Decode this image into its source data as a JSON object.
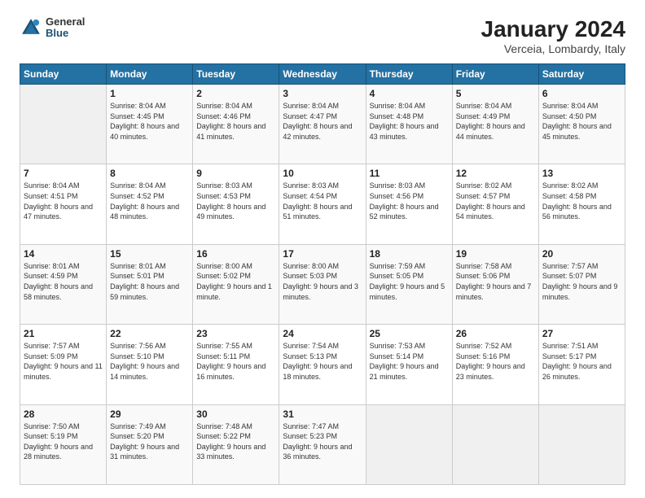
{
  "header": {
    "logo": {
      "general": "General",
      "blue": "Blue"
    },
    "title": "January 2024",
    "subtitle": "Verceia, Lombardy, Italy"
  },
  "weekdays": [
    "Sunday",
    "Monday",
    "Tuesday",
    "Wednesday",
    "Thursday",
    "Friday",
    "Saturday"
  ],
  "weeks": [
    [
      {
        "day": "",
        "sunrise": "",
        "sunset": "",
        "daylight": "",
        "empty": true
      },
      {
        "day": "1",
        "sunrise": "Sunrise: 8:04 AM",
        "sunset": "Sunset: 4:45 PM",
        "daylight": "Daylight: 8 hours and 40 minutes."
      },
      {
        "day": "2",
        "sunrise": "Sunrise: 8:04 AM",
        "sunset": "Sunset: 4:46 PM",
        "daylight": "Daylight: 8 hours and 41 minutes."
      },
      {
        "day": "3",
        "sunrise": "Sunrise: 8:04 AM",
        "sunset": "Sunset: 4:47 PM",
        "daylight": "Daylight: 8 hours and 42 minutes."
      },
      {
        "day": "4",
        "sunrise": "Sunrise: 8:04 AM",
        "sunset": "Sunset: 4:48 PM",
        "daylight": "Daylight: 8 hours and 43 minutes."
      },
      {
        "day": "5",
        "sunrise": "Sunrise: 8:04 AM",
        "sunset": "Sunset: 4:49 PM",
        "daylight": "Daylight: 8 hours and 44 minutes."
      },
      {
        "day": "6",
        "sunrise": "Sunrise: 8:04 AM",
        "sunset": "Sunset: 4:50 PM",
        "daylight": "Daylight: 8 hours and 45 minutes."
      }
    ],
    [
      {
        "day": "7",
        "sunrise": "Sunrise: 8:04 AM",
        "sunset": "Sunset: 4:51 PM",
        "daylight": "Daylight: 8 hours and 47 minutes."
      },
      {
        "day": "8",
        "sunrise": "Sunrise: 8:04 AM",
        "sunset": "Sunset: 4:52 PM",
        "daylight": "Daylight: 8 hours and 48 minutes."
      },
      {
        "day": "9",
        "sunrise": "Sunrise: 8:03 AM",
        "sunset": "Sunset: 4:53 PM",
        "daylight": "Daylight: 8 hours and 49 minutes."
      },
      {
        "day": "10",
        "sunrise": "Sunrise: 8:03 AM",
        "sunset": "Sunset: 4:54 PM",
        "daylight": "Daylight: 8 hours and 51 minutes."
      },
      {
        "day": "11",
        "sunrise": "Sunrise: 8:03 AM",
        "sunset": "Sunset: 4:56 PM",
        "daylight": "Daylight: 8 hours and 52 minutes."
      },
      {
        "day": "12",
        "sunrise": "Sunrise: 8:02 AM",
        "sunset": "Sunset: 4:57 PM",
        "daylight": "Daylight: 8 hours and 54 minutes."
      },
      {
        "day": "13",
        "sunrise": "Sunrise: 8:02 AM",
        "sunset": "Sunset: 4:58 PM",
        "daylight": "Daylight: 8 hours and 56 minutes."
      }
    ],
    [
      {
        "day": "14",
        "sunrise": "Sunrise: 8:01 AM",
        "sunset": "Sunset: 4:59 PM",
        "daylight": "Daylight: 8 hours and 58 minutes."
      },
      {
        "day": "15",
        "sunrise": "Sunrise: 8:01 AM",
        "sunset": "Sunset: 5:01 PM",
        "daylight": "Daylight: 8 hours and 59 minutes."
      },
      {
        "day": "16",
        "sunrise": "Sunrise: 8:00 AM",
        "sunset": "Sunset: 5:02 PM",
        "daylight": "Daylight: 9 hours and 1 minute."
      },
      {
        "day": "17",
        "sunrise": "Sunrise: 8:00 AM",
        "sunset": "Sunset: 5:03 PM",
        "daylight": "Daylight: 9 hours and 3 minutes."
      },
      {
        "day": "18",
        "sunrise": "Sunrise: 7:59 AM",
        "sunset": "Sunset: 5:05 PM",
        "daylight": "Daylight: 9 hours and 5 minutes."
      },
      {
        "day": "19",
        "sunrise": "Sunrise: 7:58 AM",
        "sunset": "Sunset: 5:06 PM",
        "daylight": "Daylight: 9 hours and 7 minutes."
      },
      {
        "day": "20",
        "sunrise": "Sunrise: 7:57 AM",
        "sunset": "Sunset: 5:07 PM",
        "daylight": "Daylight: 9 hours and 9 minutes."
      }
    ],
    [
      {
        "day": "21",
        "sunrise": "Sunrise: 7:57 AM",
        "sunset": "Sunset: 5:09 PM",
        "daylight": "Daylight: 9 hours and 11 minutes."
      },
      {
        "day": "22",
        "sunrise": "Sunrise: 7:56 AM",
        "sunset": "Sunset: 5:10 PM",
        "daylight": "Daylight: 9 hours and 14 minutes."
      },
      {
        "day": "23",
        "sunrise": "Sunrise: 7:55 AM",
        "sunset": "Sunset: 5:11 PM",
        "daylight": "Daylight: 9 hours and 16 minutes."
      },
      {
        "day": "24",
        "sunrise": "Sunrise: 7:54 AM",
        "sunset": "Sunset: 5:13 PM",
        "daylight": "Daylight: 9 hours and 18 minutes."
      },
      {
        "day": "25",
        "sunrise": "Sunrise: 7:53 AM",
        "sunset": "Sunset: 5:14 PM",
        "daylight": "Daylight: 9 hours and 21 minutes."
      },
      {
        "day": "26",
        "sunrise": "Sunrise: 7:52 AM",
        "sunset": "Sunset: 5:16 PM",
        "daylight": "Daylight: 9 hours and 23 minutes."
      },
      {
        "day": "27",
        "sunrise": "Sunrise: 7:51 AM",
        "sunset": "Sunset: 5:17 PM",
        "daylight": "Daylight: 9 hours and 26 minutes."
      }
    ],
    [
      {
        "day": "28",
        "sunrise": "Sunrise: 7:50 AM",
        "sunset": "Sunset: 5:19 PM",
        "daylight": "Daylight: 9 hours and 28 minutes."
      },
      {
        "day": "29",
        "sunrise": "Sunrise: 7:49 AM",
        "sunset": "Sunset: 5:20 PM",
        "daylight": "Daylight: 9 hours and 31 minutes."
      },
      {
        "day": "30",
        "sunrise": "Sunrise: 7:48 AM",
        "sunset": "Sunset: 5:22 PM",
        "daylight": "Daylight: 9 hours and 33 minutes."
      },
      {
        "day": "31",
        "sunrise": "Sunrise: 7:47 AM",
        "sunset": "Sunset: 5:23 PM",
        "daylight": "Daylight: 9 hours and 36 minutes."
      },
      {
        "day": "",
        "sunrise": "",
        "sunset": "",
        "daylight": "",
        "empty": true
      },
      {
        "day": "",
        "sunrise": "",
        "sunset": "",
        "daylight": "",
        "empty": true
      },
      {
        "day": "",
        "sunrise": "",
        "sunset": "",
        "daylight": "",
        "empty": true
      }
    ]
  ]
}
